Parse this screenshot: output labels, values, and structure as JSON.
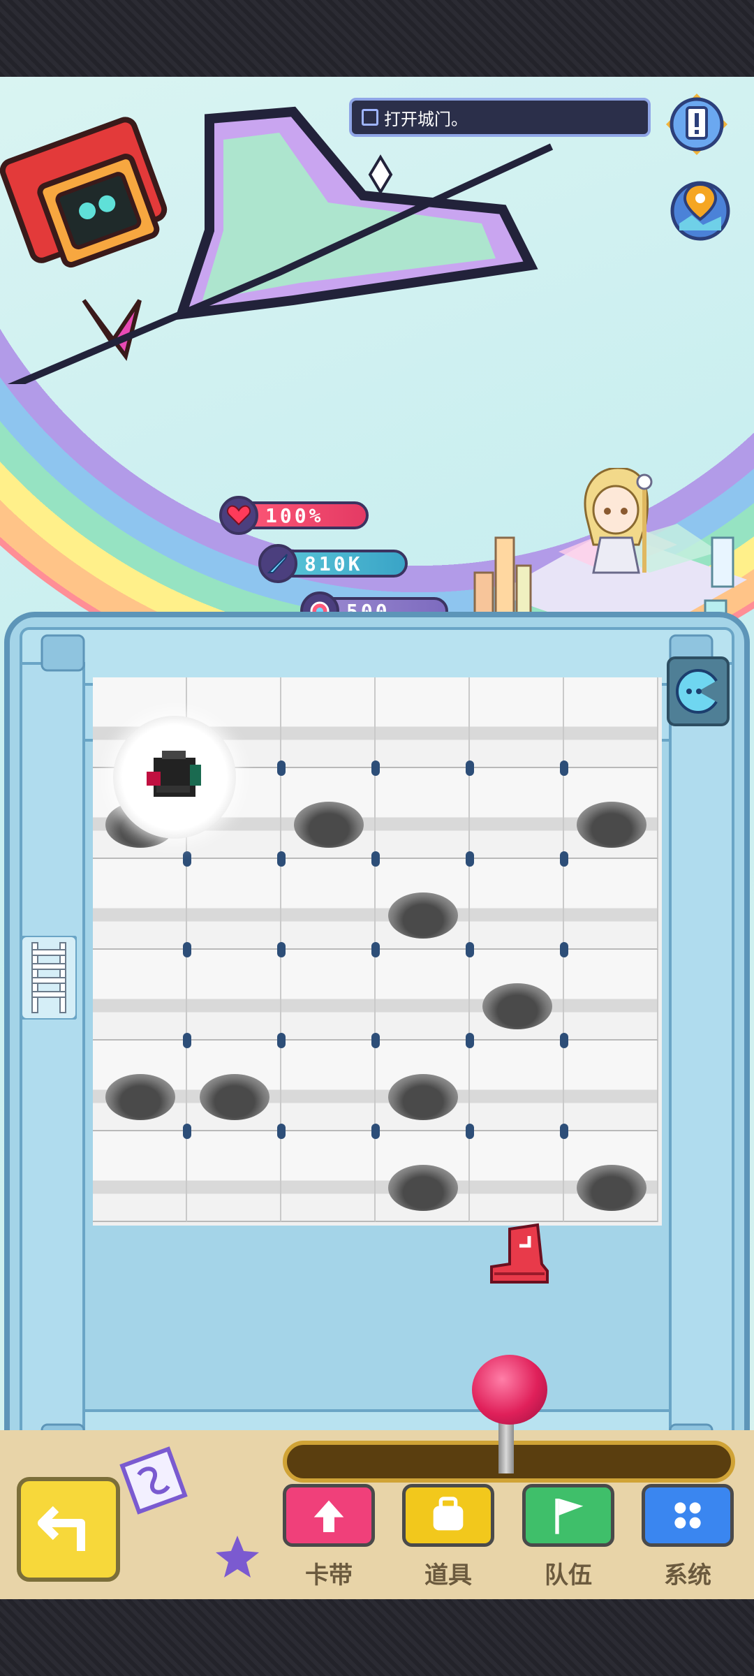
{
  "quest": {
    "text": "打开城门。"
  },
  "stats": {
    "hp": "100%",
    "attack": "810K",
    "gems": "500"
  },
  "menu": [
    {
      "label": "卡带",
      "color": "#f0407a",
      "icon": "arrow-up-icon"
    },
    {
      "label": "道具",
      "color": "#f2c81c",
      "icon": "bag-icon"
    },
    {
      "label": "队伍",
      "color": "#3fbf6a",
      "icon": "flag-icon"
    },
    {
      "label": "系统",
      "color": "#3a86f0",
      "icon": "grid-icon"
    }
  ],
  "board": {
    "columns": 6,
    "rows": 6
  },
  "icons": [
    "alert-icon",
    "map-pin-icon",
    "chat-icon",
    "ladder-icon",
    "boot-icon",
    "back-arrow-icon",
    "tape-card-icon",
    "star-icon",
    "heart-icon",
    "sword-icon",
    "gem-icon"
  ]
}
